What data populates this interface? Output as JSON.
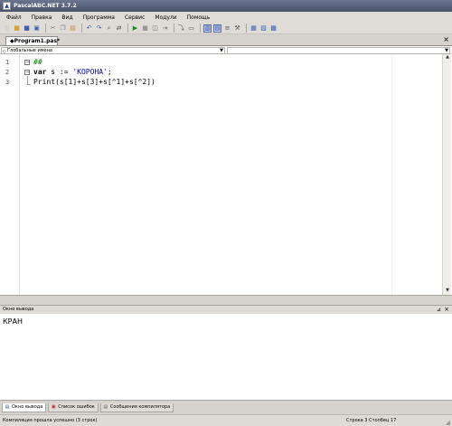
{
  "window": {
    "title": "PascalABC.NET 3.7.2"
  },
  "menu": [
    "Файл",
    "Правка",
    "Вид",
    "Программа",
    "Сервис",
    "Модули",
    "Помощь"
  ],
  "toolbar": {
    "icons": [
      "new-file-icon",
      "open-icon",
      "save-icon",
      "save-all-icon",
      "cut-icon",
      "copy-icon",
      "paste-icon",
      "undo-icon",
      "redo-icon",
      "find-icon",
      "replace-icon",
      "run-icon",
      "stop-icon",
      "debug-icon",
      "step-icon",
      "step-over-icon",
      "toggle-editor-icon",
      "split-view-icon",
      "output-window-icon",
      "format-icon",
      "tools-icon",
      "module-icon",
      "settings-icon"
    ]
  },
  "tab": {
    "label": "◆Program1.pas*",
    "close": "×"
  },
  "selectors": {
    "scope": "Глобальные имена"
  },
  "editor": {
    "line_numbers": [
      "1",
      "2",
      "3"
    ],
    "lines": [
      {
        "tokens": [
          {
            "t": "##",
            "c": "cm"
          }
        ]
      },
      {
        "tokens": [
          {
            "t": "var",
            "c": "kw"
          },
          {
            "t": " s := "
          },
          {
            "t": "'КОРОНА'",
            "c": "str"
          },
          {
            "t": ";"
          }
        ]
      },
      {
        "tokens": [
          {
            "t": "Print(s[1]+s[3]+s[^1]+s[^2])"
          }
        ]
      }
    ]
  },
  "output": {
    "header": "Окно вывода",
    "text": "КРАН"
  },
  "bottom_tabs": [
    "Окно вывода",
    "Список ошибок",
    "Сообщения компилятора"
  ],
  "status": {
    "left": "Компиляция прошла успешно (3 строк)",
    "right": "Строка  3  Столбец  17"
  }
}
